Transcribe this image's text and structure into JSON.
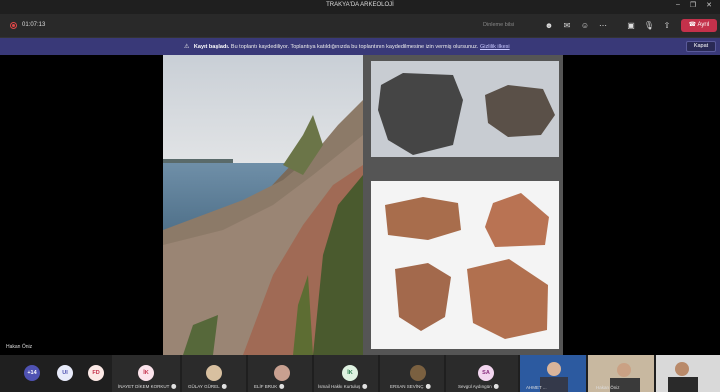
{
  "window": {
    "title": "TRAKYA'DA ARKEOLOJİ"
  },
  "toolbar": {
    "timer": "01:07:13",
    "chat_hint": "Dinleme bilsi",
    "leave_label": "Ayrıl"
  },
  "banner": {
    "bold": "Kayıt başladı.",
    "text": "Bu toplantı kaydediliyor. Toplantıya katıldığınızda bu toplantının kaydedilmesine izin vermiş olursunuz.",
    "link": "Gizlilik ilkesi",
    "close_label": "Kapat"
  },
  "stage": {
    "presenter": "Hakan Öniz"
  },
  "participants": {
    "overflow": "+14",
    "initials": [
      {
        "initials": "UI",
        "color": "#e8ebfa",
        "text_color": "#4f52b2"
      },
      {
        "initials": "FD",
        "color": "#fce9e6",
        "text_color": "#c4314b"
      }
    ],
    "tiles": [
      {
        "initials": "İK",
        "name": "İNAYET DİKEM KORKUT",
        "color": "#fce4ec",
        "text_color": "#c4314b"
      },
      {
        "initials": "",
        "name": "GÜLAY GÜREL",
        "color": "#d8c0a0",
        "text_color": "#333"
      },
      {
        "initials": "",
        "name": "ELİF BRUK",
        "color": "#c8a090",
        "text_color": "#333"
      },
      {
        "initials": "İK",
        "name": "İsmail Hakkı Kurtuluş",
        "color": "#dff2e1",
        "text_color": "#237b4b"
      },
      {
        "initials": "",
        "name": "ERSAN SEVİNÇ",
        "color": "#7a6040",
        "text_color": "#fff"
      },
      {
        "initials": "SA",
        "name": "Sevgül Aydıngün",
        "color": "#f3d6f0",
        "text_color": "#8a2d7f"
      }
    ],
    "video": [
      {
        "name": "AHMET ...",
        "bg": "#2c5aa0"
      },
      {
        "name": "Hakan Öniz",
        "bg": "#c8b8a0"
      },
      {
        "name": "",
        "bg": "#d9d9d9"
      }
    ]
  },
  "colors": {
    "leave": "#c4314b",
    "banner": "#393978",
    "accent": "#6264a7"
  }
}
